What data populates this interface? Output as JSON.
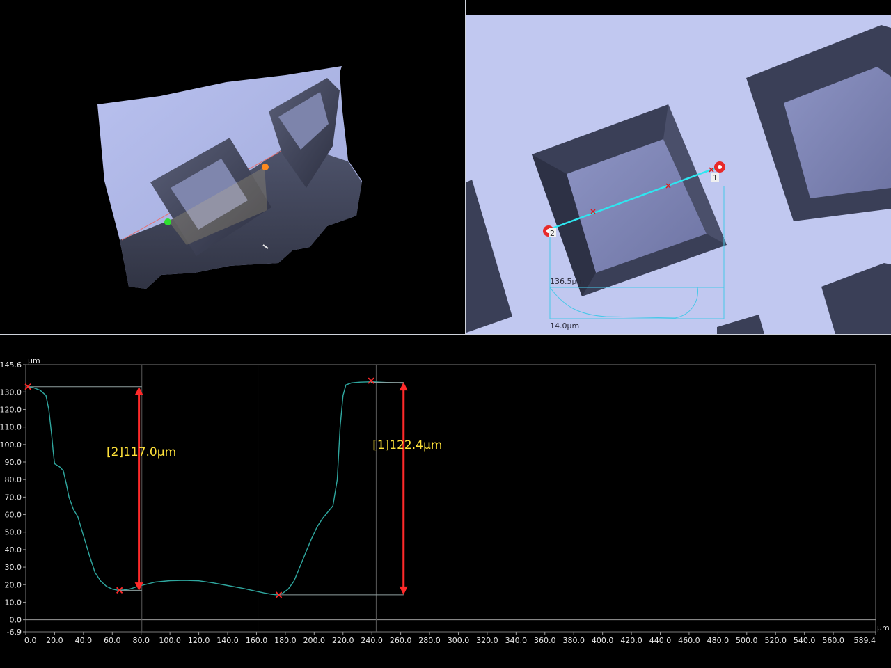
{
  "view2d": {
    "width_label": "136.5µm",
    "height_label": "14.0µm",
    "point1": "1",
    "point2": "2"
  },
  "profile": {
    "y_unit": "µm",
    "x_unit": "µm",
    "y_ticks": [
      "145.6",
      "130.0",
      "120.0",
      "110.0",
      "100.0",
      "90.0",
      "80.0",
      "70.0",
      "60.0",
      "50.0",
      "40.0",
      "30.0",
      "20.0",
      "10.0",
      "0.0",
      "-6.9"
    ],
    "x_ticks": [
      "0.0",
      "20.0",
      "40.0",
      "60.0",
      "80.0",
      "100.0",
      "120.0",
      "140.0",
      "160.0",
      "180.0",
      "200.0",
      "220.0",
      "240.0",
      "260.0",
      "280.0",
      "300.0",
      "320.0",
      "340.0",
      "360.0",
      "380.0",
      "400.0",
      "420.0",
      "440.0",
      "460.0",
      "480.0",
      "500.0",
      "520.0",
      "540.0",
      "560.0",
      "589.4"
    ],
    "measure_1": "[1]122.4µm",
    "measure_2": "[2]117.0µm"
  },
  "chart_data": {
    "type": "line",
    "xlabel": "µm",
    "ylabel": "µm",
    "xlim": [
      0,
      589.4
    ],
    "ylim": [
      -6.9,
      145.6
    ],
    "colors": {
      "profile": "#2fa79f",
      "marker": "#ff2a2a",
      "label": "#ffe23a"
    },
    "series": [
      {
        "x": [
          1,
          5,
          10,
          14,
          16,
          18,
          19,
          20,
          22,
          24,
          26,
          28,
          30,
          33,
          36,
          40,
          44,
          48,
          52,
          56,
          60,
          64,
          68,
          72,
          76,
          80,
          90,
          100,
          110,
          120,
          130,
          140,
          150,
          160,
          165,
          170,
          174,
          178,
          182,
          186,
          190,
          194,
          198,
          202,
          206,
          210,
          213,
          216,
          218,
          220,
          222,
          226,
          232,
          240,
          250,
          260,
          262
        ],
        "values": [
          133.0,
          132.5,
          131.0,
          128.0,
          120.0,
          105.0,
          96.0,
          89.0,
          88.0,
          87.0,
          85.0,
          78.0,
          70.0,
          63.0,
          59.0,
          48.0,
          37.0,
          27.0,
          22.0,
          19.0,
          17.5,
          16.8,
          17.0,
          17.5,
          18.5,
          19.5,
          21.5,
          22.3,
          22.5,
          22.2,
          21.0,
          19.5,
          18.0,
          16.2,
          15.3,
          14.6,
          14.2,
          15.0,
          17.5,
          22.0,
          30.0,
          38.0,
          46.0,
          53.0,
          58.0,
          62.0,
          65.0,
          80.0,
          110.0,
          128.0,
          134.0,
          135.2,
          135.6,
          135.8,
          135.4,
          135.1,
          135.0
        ]
      }
    ],
    "markers": [
      {
        "x": 1.5,
        "y": 133.0
      },
      {
        "x": 65.0,
        "y": 16.8
      },
      {
        "x": 175.5,
        "y": 14.2
      },
      {
        "x": 239.5,
        "y": 136.4
      }
    ]
  }
}
